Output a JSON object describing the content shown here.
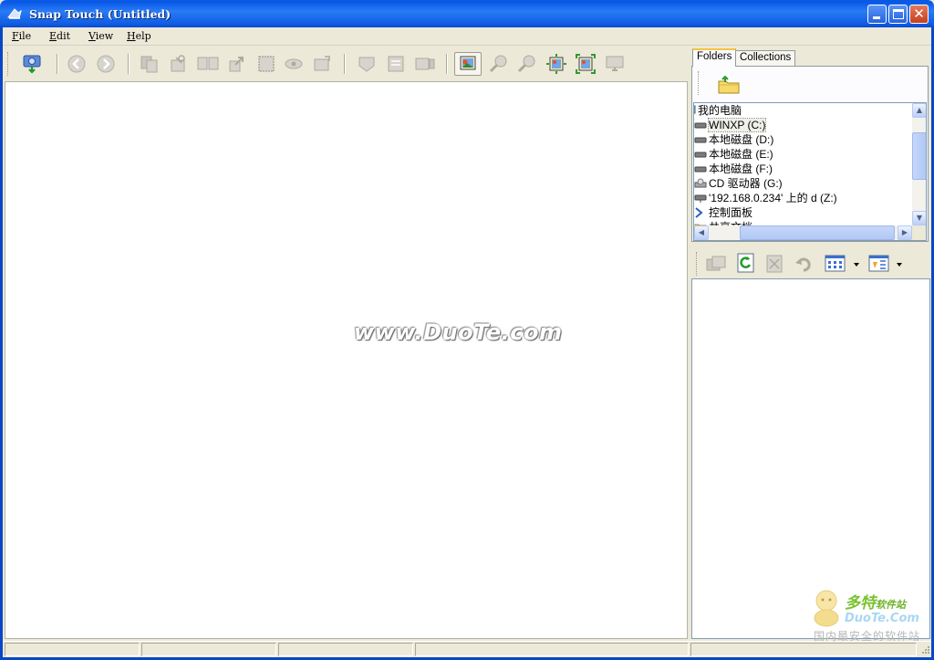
{
  "window": {
    "title": "Snap Touch (Untitled)",
    "colors": {
      "titlebar": "#0A5BE0",
      "close": "#C4401F",
      "chrome": "#ECE9D8"
    }
  },
  "menu": {
    "items": [
      "File",
      "Edit",
      "View",
      "Help"
    ]
  },
  "toolbar": {
    "icons": [
      "acquire-icon",
      "back-icon",
      "forward-icon",
      "copy-icon",
      "cut-icon",
      "compare-icon",
      "export-icon",
      "select-icon",
      "view-icon",
      "crop-icon",
      "save-icon",
      "print-icon",
      "slideshow-icon",
      "fit-image-icon",
      "zoom-in-icon",
      "zoom-out-icon",
      "actual-size-icon",
      "full-screen-icon",
      "monitor-icon"
    ]
  },
  "viewer": {
    "watermark": "www.DuoTe.com"
  },
  "side_panel": {
    "tabs": [
      "Folders",
      "Collections"
    ],
    "active_tab": "Folders",
    "tree": [
      {
        "label": "我的电脑",
        "icon": "computer-icon"
      },
      {
        "label": "WINXP (C:)",
        "icon": "drive-icon",
        "selected": true
      },
      {
        "label": "本地磁盘 (D:)",
        "icon": "drive-icon"
      },
      {
        "label": "本地磁盘 (E:)",
        "icon": "drive-icon"
      },
      {
        "label": "本地磁盘 (F:)",
        "icon": "drive-icon"
      },
      {
        "label": "CD 驱动器 (G:)",
        "icon": "cd-drive-icon"
      },
      {
        "label": "'192.168.0.234' 上的 d (Z:)",
        "icon": "network-drive-icon"
      },
      {
        "label": "控制面板",
        "icon": "control-panel-icon"
      },
      {
        "label": "共享文档",
        "icon": "folder-icon"
      }
    ],
    "list_toolbar_icons": [
      "copy-icon",
      "refresh-icon",
      "delete-icon",
      "undo-icon",
      "view-mode-icon",
      "sort-icon"
    ]
  },
  "status_bar": {
    "cells": [
      "",
      "",
      "",
      "",
      ""
    ]
  },
  "logo": {
    "name": "多特",
    "suffix": "软件站",
    "site": "DuoTe.Com",
    "tagline": "国内最安全的软件站"
  }
}
